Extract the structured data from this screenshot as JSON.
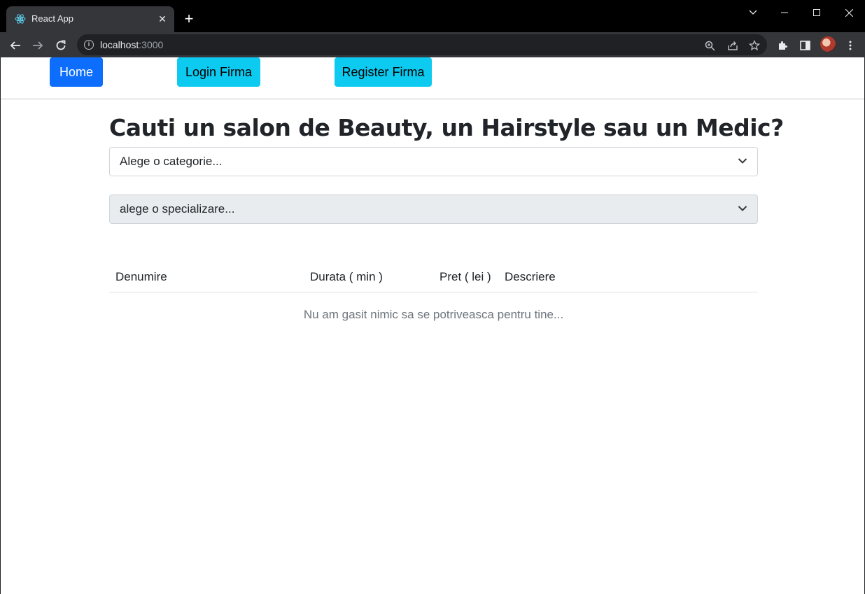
{
  "browser": {
    "tab_title": "React App",
    "new_tab_label": "+",
    "url_host": "localhost",
    "url_port": ":3000",
    "icons": [
      "react-icon",
      "close-icon",
      "new-tab-icon",
      "tab-list-chevron-icon",
      "minimize-icon",
      "maximize-icon",
      "window-close-icon",
      "back-icon",
      "forward-icon",
      "reload-icon",
      "info-icon",
      "zoom-icon",
      "share-icon",
      "star-icon",
      "extensions-icon",
      "side-panel-icon",
      "profile-avatar",
      "menu-icon"
    ]
  },
  "navbar": {
    "home_label": "Home",
    "login_label": "Login Firma",
    "register_label": "Register Firma",
    "colors": {
      "primary": "#0d6efd",
      "info": "#0dcaf0"
    }
  },
  "main": {
    "heading": "Cauti un salon de Beauty, un Hairstyle sau un Medic?",
    "category_select": {
      "selected": "Alege o categorie..."
    },
    "specialization_select": {
      "selected": "alege o specializare...",
      "disabled": true
    },
    "table": {
      "columns": [
        "Denumire",
        "Durata ( min )",
        "Pret ( lei )",
        "Descriere"
      ],
      "rows": [],
      "empty_message": "Nu am gasit nimic sa se potriveasca pentru tine..."
    }
  }
}
